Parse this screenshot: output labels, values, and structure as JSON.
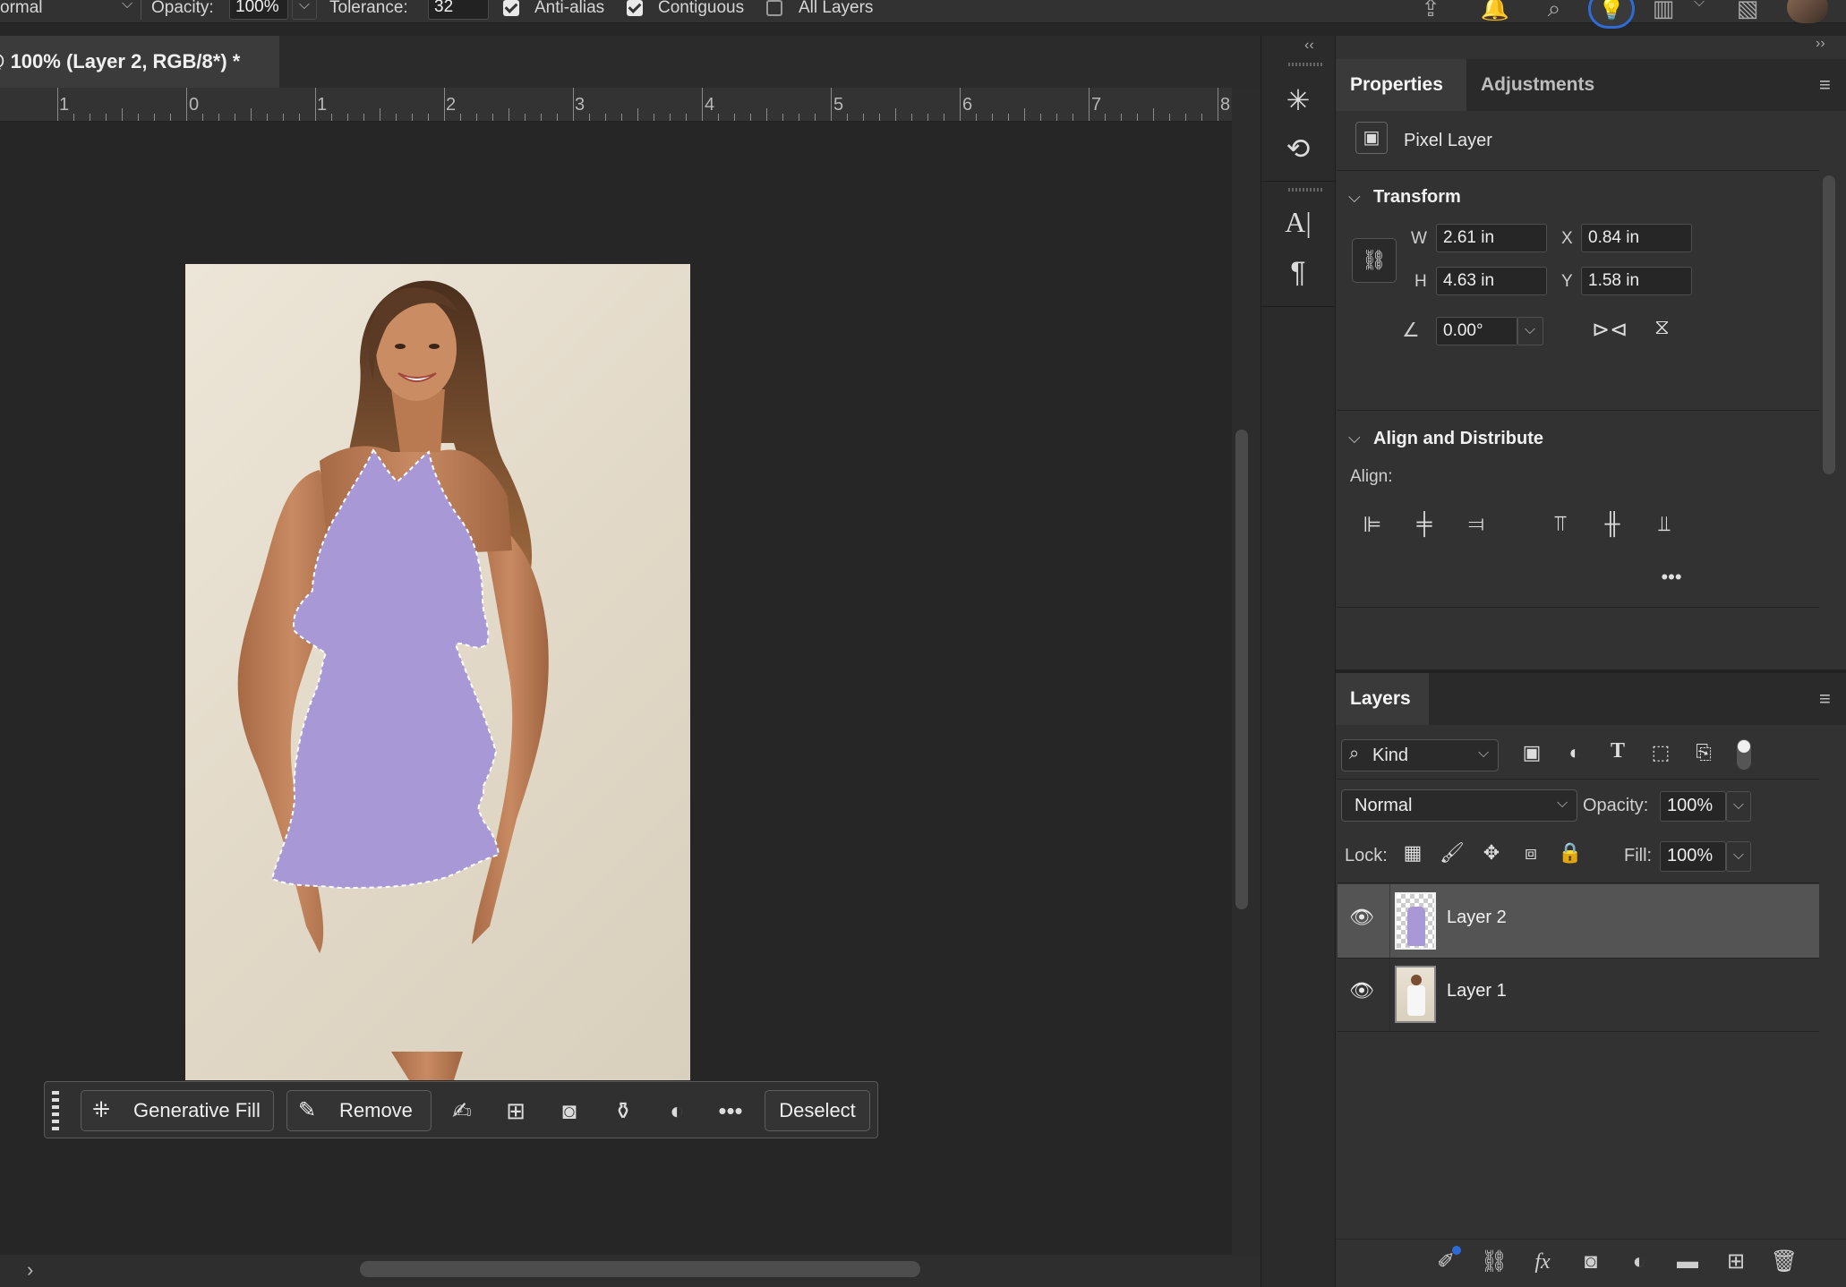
{
  "options_bar": {
    "mode_value": "ormal",
    "opacity_label": "Opacity:",
    "opacity_value": "100%",
    "tolerance_label": "Tolerance:",
    "tolerance_value": "32",
    "anti_alias_label": "Anti-alias",
    "anti_alias_checked": true,
    "contiguous_label": "Contiguous",
    "contiguous_checked": true,
    "all_layers_label": "All Layers",
    "all_layers_checked": false
  },
  "document": {
    "tab_title": "@ 100% (Layer 2, RGB/8*) *"
  },
  "ruler": {
    "labels": [
      "1",
      "0",
      "1",
      "2",
      "3",
      "4",
      "5",
      "6",
      "7",
      "8"
    ]
  },
  "taskbar": {
    "generative_fill_label": "Generative Fill",
    "remove_label": "Remove",
    "deselect_label": "Deselect"
  },
  "properties": {
    "tab_properties": "Properties",
    "tab_adjustments": "Adjustments",
    "layer_kind": "Pixel Layer",
    "transform_title": "Transform",
    "w_label": "W",
    "w_value": "2.61 in",
    "h_label": "H",
    "h_value": "4.63 in",
    "x_label": "X",
    "x_value": "0.84 in",
    "y_label": "Y",
    "y_value": "1.58 in",
    "angle_value": "0.00°",
    "align_title": "Align and Distribute",
    "align_label": "Align:"
  },
  "layers": {
    "tab_label": "Layers",
    "filter_label": "Kind",
    "blend_mode": "Normal",
    "opacity_label": "Opacity:",
    "opacity_value": "100%",
    "lock_label": "Lock:",
    "fill_label": "Fill:",
    "fill_value": "100%",
    "items": [
      {
        "name": "Layer 2",
        "selected": true
      },
      {
        "name": "Layer 1",
        "selected": false
      }
    ]
  },
  "colors": {
    "selection_fill": "#a898d6",
    "accent": "#2f6bd6"
  }
}
